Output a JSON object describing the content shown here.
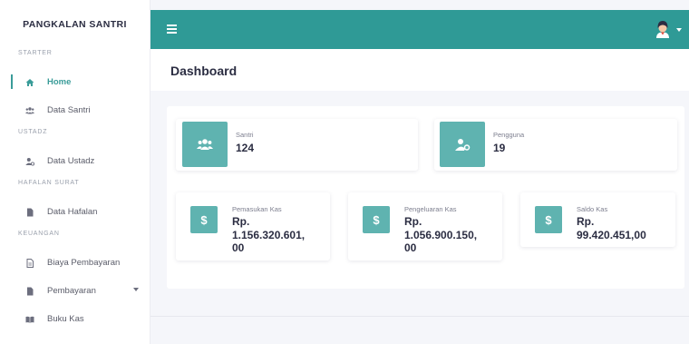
{
  "sidebar": {
    "brand": "PANGKALAN SANTRI",
    "sections": {
      "starter": "STARTER",
      "ustadz": "USTADZ",
      "hafalan": "HAFALAN SURAT",
      "keuangan": "KEUANGAN"
    },
    "items": {
      "home": "Home",
      "data_santri": "Data Santri",
      "data_ustadz": "Data Ustadz",
      "data_hafalan": "Data Hafalan",
      "biaya_pembayaran": "Biaya Pembayaran",
      "pembayaran": "Pembayaran",
      "buku_kas": "Buku Kas"
    }
  },
  "header": {
    "title": "Dashboard"
  },
  "stats": {
    "santri": {
      "label": "Santri",
      "value": "124"
    },
    "pengguna": {
      "label": "Pengguna",
      "value": "19"
    }
  },
  "finance": {
    "pemasukan": {
      "label": "Pemasukan Kas",
      "value_line1": "Rp.",
      "value_line2": "1.156.320.601,",
      "value_line3": "00"
    },
    "pengeluaran": {
      "label": "Pengeluaran Kas",
      "value_line1": "Rp.",
      "value_line2": "1.056.900.150,",
      "value_line3": "00"
    },
    "saldo": {
      "label": "Saldo Kas",
      "value_line1": "Rp.",
      "value_line2": "99.420.451,00"
    }
  },
  "colors": {
    "accent": "#2f9a96",
    "icon_box": "#5fb3b0"
  }
}
